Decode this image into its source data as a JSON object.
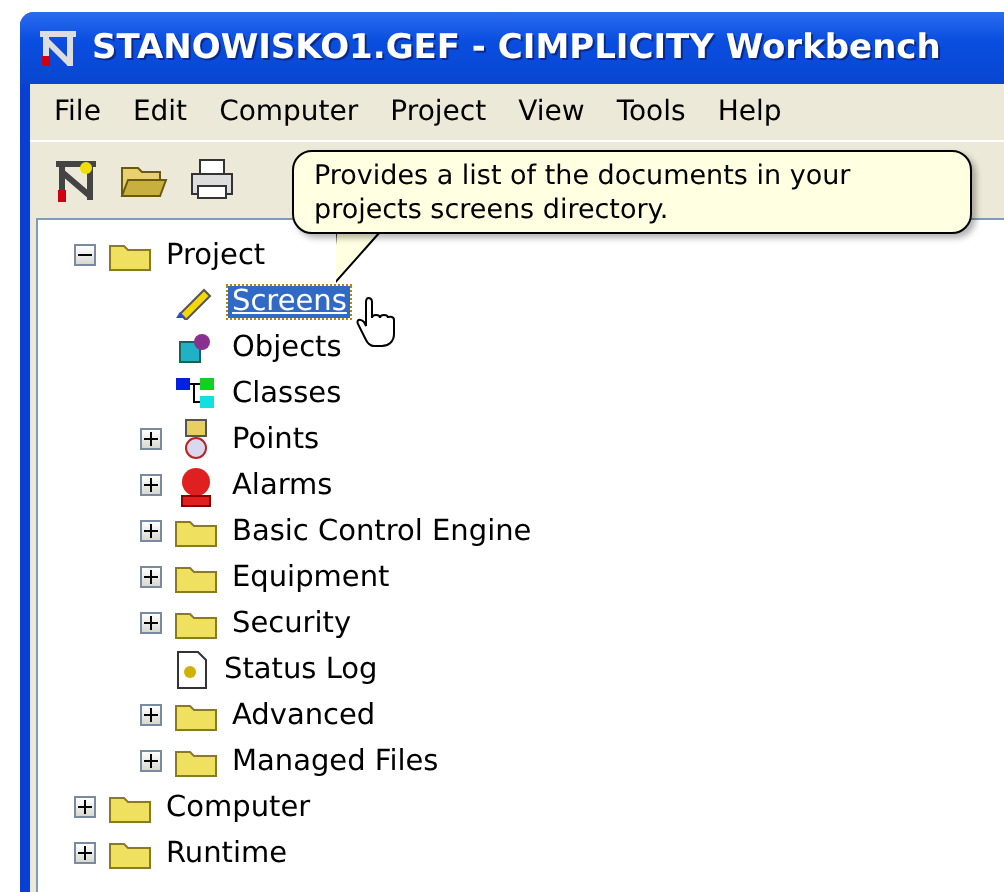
{
  "window": {
    "title": "STANOWISKO1.GEF - CIMPLICITY Workbench"
  },
  "menu": [
    "File",
    "Edit",
    "Computer",
    "Project",
    "View",
    "Tools",
    "Help"
  ],
  "toolbar": [
    {
      "kind": "workbench"
    },
    {
      "kind": "open"
    },
    {
      "kind": "print"
    }
  ],
  "tooltip": {
    "text": "Provides a list of the documents in your projects screens directory."
  },
  "tree": [
    {
      "label": "Project",
      "kind": "folder",
      "expanded": true,
      "selected": false,
      "children": [
        {
          "label": "Screens",
          "kind": "screens",
          "selected": true
        },
        {
          "label": "Objects",
          "kind": "objects",
          "selected": false
        },
        {
          "label": "Classes",
          "kind": "classes",
          "selected": false
        },
        {
          "label": "Points",
          "kind": "points",
          "expanded": false,
          "selected": false
        },
        {
          "label": "Alarms",
          "kind": "alarms",
          "expanded": false,
          "selected": false
        },
        {
          "label": "Basic Control Engine",
          "kind": "folder",
          "expanded": false,
          "selected": false
        },
        {
          "label": "Equipment",
          "kind": "folder",
          "expanded": false,
          "selected": false
        },
        {
          "label": "Security",
          "kind": "folder",
          "expanded": false,
          "selected": false
        },
        {
          "label": "Status Log",
          "kind": "log",
          "selected": false
        },
        {
          "label": "Advanced",
          "kind": "folder",
          "expanded": false,
          "selected": false
        },
        {
          "label": "Managed Files",
          "kind": "folder",
          "expanded": false,
          "selected": false
        }
      ]
    },
    {
      "label": "Computer",
      "kind": "folder",
      "expanded": false,
      "selected": false
    },
    {
      "label": "Runtime",
      "kind": "folder",
      "expanded": false,
      "selected": false
    }
  ]
}
